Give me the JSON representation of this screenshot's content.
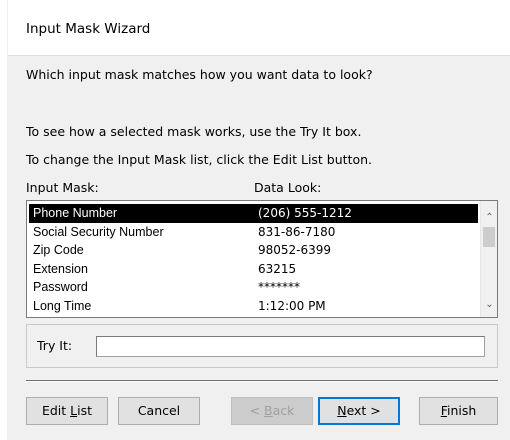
{
  "window": {
    "title": "Input Mask Wizard"
  },
  "instructions": {
    "question": "Which input mask matches how you want data to look?",
    "try_hint": "To see how a selected mask works, use the Try It box.",
    "edit_hint": "To change the Input Mask list, click the Edit List button."
  },
  "list": {
    "columns": [
      "Input Mask:",
      "Data Look:"
    ],
    "selected_index": 0,
    "rows": [
      {
        "mask": "Phone Number",
        "look": "(206) 555-1212"
      },
      {
        "mask": "Social Security Number",
        "look": "831-86-7180"
      },
      {
        "mask": "Zip Code",
        "look": "98052-6399"
      },
      {
        "mask": "Extension",
        "look": "63215"
      },
      {
        "mask": "Password",
        "look": "*******"
      },
      {
        "mask": "Long Time",
        "look": "1:12:00 PM"
      }
    ]
  },
  "try_it": {
    "label": "Try It:",
    "value": ""
  },
  "buttons": {
    "edit_list": {
      "pre": "Edit ",
      "key": "L",
      "post": "ist"
    },
    "cancel": "Cancel",
    "back": {
      "pre": "< ",
      "key": "B",
      "post": "ack"
    },
    "next": {
      "key": "N",
      "post": "ext >"
    },
    "finish": {
      "key": "F",
      "post": "inish"
    }
  }
}
